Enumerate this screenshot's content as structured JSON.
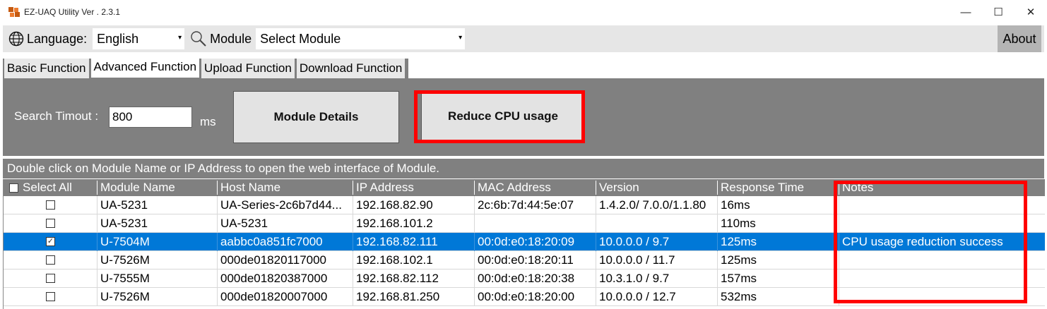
{
  "window": {
    "title": "EZ-UAQ Utility Ver . 2.3.1",
    "minimize": "—",
    "maximize": "☐",
    "close": "✕"
  },
  "toolbar": {
    "language_label": "Language:",
    "language_value": "English",
    "module_label": "Module",
    "module_value": "Select Module",
    "about_label": "About"
  },
  "tabs": [
    {
      "label": "Basic Function",
      "active": false
    },
    {
      "label": "Advanced Function",
      "active": true
    },
    {
      "label": "Upload Function",
      "active": false
    },
    {
      "label": "Download Function",
      "active": false
    }
  ],
  "panel": {
    "timeout_label": "Search Timout :",
    "timeout_value": "800",
    "timeout_unit": "ms",
    "details_button": "Module Details",
    "reduce_button": "Reduce CPU usage"
  },
  "hint": "Double click on Module Name or IP Address to open the web interface of Module.",
  "table": {
    "select_all": "Select All",
    "columns": [
      "Module Name",
      "Host Name",
      "IP Address",
      "MAC Address",
      "Version",
      "Response Time",
      "Notes"
    ],
    "rows": [
      {
        "checked": false,
        "selected": false,
        "cells": [
          "UA-5231",
          "UA-Series-2c6b7d44...",
          "192.168.82.90",
          "2c:6b:7d:44:5e:07",
          "1.4.2.0/ 7.0.0/1.1.80",
          "16ms",
          ""
        ]
      },
      {
        "checked": false,
        "selected": false,
        "cells": [
          "UA-5231",
          "UA-5231",
          "192.168.101.2",
          "",
          "",
          "110ms",
          ""
        ]
      },
      {
        "checked": true,
        "selected": true,
        "cells": [
          "U-7504M",
          "aabbc0a851fc7000",
          "192.168.82.111",
          "00:0d:e0:18:20:09",
          "10.0.0.0 / 9.7",
          "125ms",
          "CPU usage reduction success"
        ]
      },
      {
        "checked": false,
        "selected": false,
        "cells": [
          "U-7526M",
          "000de01820117000",
          "192.168.102.1",
          "00:0d:e0:18:20:11",
          "10.0.0.0 / 11.7",
          "125ms",
          ""
        ]
      },
      {
        "checked": false,
        "selected": false,
        "cells": [
          "U-7555M",
          "000de01820387000",
          "192.168.82.112",
          "00:0d:e0:18:20:38",
          "10.3.1.0 / 9.7",
          "157ms",
          ""
        ]
      },
      {
        "checked": false,
        "selected": false,
        "cells": [
          "U-7526M",
          "000de01820007000",
          "192.168.81.250",
          "00:0d:e0:18:20:00",
          "10.0.0.0 / 12.7",
          "532ms",
          ""
        ]
      }
    ]
  },
  "colors": {
    "highlight": "#ff0000",
    "selection": "#0078d7",
    "panel_gray": "#808080"
  }
}
